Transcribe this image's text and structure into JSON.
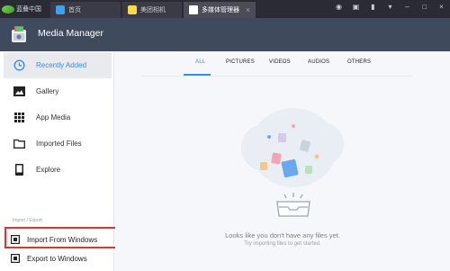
{
  "window": {
    "app_logo_text": "蓝叠中国",
    "tabs": [
      {
        "label": "首页"
      },
      {
        "label": "美团相机"
      },
      {
        "label": "多媒体管理器"
      }
    ]
  },
  "header": {
    "title": "Media Manager"
  },
  "sidebar": {
    "items": [
      {
        "label": "Recently Added",
        "icon": "clock-icon",
        "active": true
      },
      {
        "label": "Gallery",
        "icon": "photo-icon"
      },
      {
        "label": "App Media",
        "icon": "grid-icon"
      },
      {
        "label": "Imported Files",
        "icon": "folder-icon"
      },
      {
        "label": "Explore",
        "icon": "phone-icon"
      }
    ],
    "section_label": "Import / Export",
    "import_label": "Import From Windows",
    "export_label": "Export to Windows"
  },
  "filters": {
    "tabs": [
      "ALL",
      "PICTURES",
      "VIDEOS",
      "AUDIOS",
      "OTHERS"
    ],
    "active": "ALL"
  },
  "empty_state": {
    "line1": "Looks like you don't have any files yet.",
    "line2": "Try importing files to get started."
  },
  "colors": {
    "accent": "#3a8ee6",
    "header_bg": "#3f4a5d",
    "highlight_border": "#e23030"
  }
}
